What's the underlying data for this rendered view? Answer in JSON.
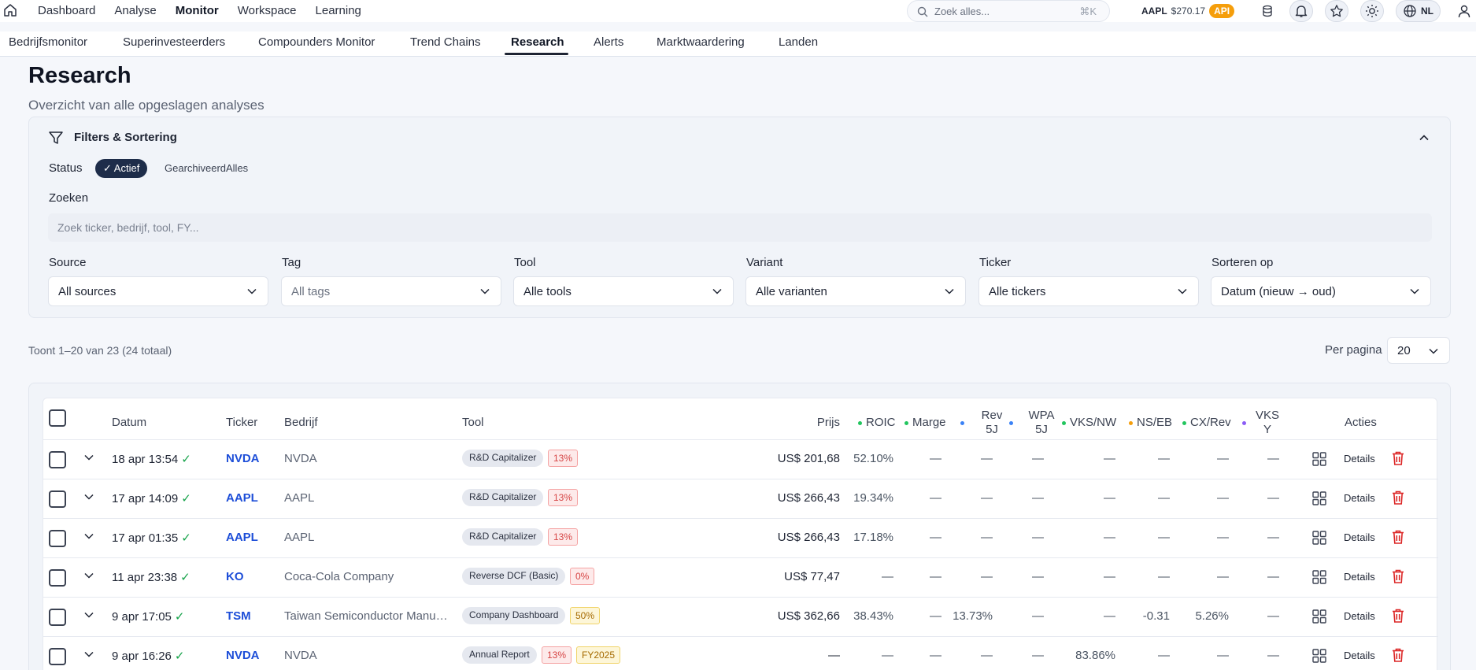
{
  "topnav": {
    "items": [
      "Dashboard",
      "Analyse",
      "Monitor",
      "Workspace",
      "Learning"
    ],
    "active": "Monitor",
    "search_placeholder": "Zoek alles...",
    "search_shortcut": "⌘K",
    "ticker_symbol": "AAPL",
    "ticker_price": "$270.17",
    "api_badge": "API",
    "language": "NL"
  },
  "subnav": {
    "items": [
      "Bedrijfsmonitor",
      "Superinvesteerders",
      "Compounders Monitor",
      "Trend Chains",
      "Research",
      "Alerts",
      "Marktwaardering",
      "Landen"
    ],
    "active": "Research"
  },
  "page": {
    "title": "Research",
    "subtitle": "Overzicht van alle opgeslagen analyses"
  },
  "filters": {
    "title": "Filters & Sortering",
    "status_label": "Status",
    "status_options": [
      "✓ Actief",
      "Gearchiveerd",
      "Alles"
    ],
    "search_label": "Zoeken",
    "search_placeholder": "Zoek ticker, bedrijf, tool, FY...",
    "selects": [
      {
        "label": "Source",
        "value": "All sources"
      },
      {
        "label": "Tag",
        "value": "All tags"
      },
      {
        "label": "Tool",
        "value": "Alle tools"
      },
      {
        "label": "Variant",
        "value": "Alle varianten"
      },
      {
        "label": "Ticker",
        "value": "Alle tickers"
      },
      {
        "label": "Sorteren op",
        "value": "Datum (nieuw → oud)"
      }
    ]
  },
  "results": {
    "count_text": "Toont 1–20 van 23 (24 totaal)",
    "per_page_label": "Per pagina",
    "per_page_value": "20"
  },
  "table": {
    "headers": {
      "datum": "Datum",
      "ticker": "Ticker",
      "bedrijf": "Bedrijf",
      "tool": "Tool",
      "prijs": "Prijs",
      "roic": "ROIC",
      "marge": "Marge",
      "rev1": "Rev",
      "rev2": "5J",
      "wpa1": "WPA",
      "wpa2": "5J",
      "vks_nw": "VKS/NW",
      "ns_eb": "NS/EB",
      "cx_rev": "CX/Rev",
      "vks1": "VKS",
      "vks2": "Y",
      "acties": "Acties"
    },
    "header_dot_colors": {
      "roic": "#22c55e",
      "marge": "#22c55e",
      "rev": "#3b82f6",
      "wpa": "#3b82f6",
      "vks_nw": "#22c55e",
      "ns_eb": "#f59e0b",
      "cx_rev": "#22c55e",
      "vks_y": "#8b5cf6"
    },
    "details_label": "Details",
    "rows": [
      {
        "date": "18 apr 13:54",
        "check": "✓",
        "ticker": "NVDA",
        "company": "NVDA",
        "tool": "R&D Capitalizer",
        "badge": "13%",
        "badge2": "",
        "price": "US$ 201,68",
        "roic": "52.10%",
        "marge": "—",
        "rev": "—",
        "wpa": "—",
        "vks_nw": "—",
        "ns_eb": "—",
        "cx_rev": "—",
        "vks_y": "—"
      },
      {
        "date": "17 apr 14:09",
        "check": "✓",
        "ticker": "AAPL",
        "company": "AAPL",
        "tool": "R&D Capitalizer",
        "badge": "13%",
        "badge2": "",
        "price": "US$ 266,43",
        "roic": "19.34%",
        "marge": "—",
        "rev": "—",
        "wpa": "—",
        "vks_nw": "—",
        "ns_eb": "—",
        "cx_rev": "—",
        "vks_y": "—"
      },
      {
        "date": "17 apr 01:35",
        "check": "✓",
        "ticker": "AAPL",
        "company": "AAPL",
        "tool": "R&D Capitalizer",
        "badge": "13%",
        "badge2": "",
        "price": "US$ 266,43",
        "roic": "17.18%",
        "marge": "—",
        "rev": "—",
        "wpa": "—",
        "vks_nw": "—",
        "ns_eb": "—",
        "cx_rev": "—",
        "vks_y": "—"
      },
      {
        "date": "11 apr 23:38",
        "check": "✓",
        "ticker": "KO",
        "company": "Coca-Cola Company",
        "tool": "Reverse DCF (Basic)",
        "badge": "0%",
        "badge2": "",
        "price": "US$ 77,47",
        "roic": "—",
        "marge": "—",
        "rev": "—",
        "wpa": "—",
        "vks_nw": "—",
        "ns_eb": "—",
        "cx_rev": "—",
        "vks_y": "—"
      },
      {
        "date": "9 apr 17:05",
        "check": "✓",
        "ticker": "TSM",
        "company": "Taiwan Semiconductor Manufa...",
        "tool": "Company Dashboard",
        "badge": "50%",
        "badge2": "",
        "price": "US$ 362,66",
        "roic": "38.43%",
        "marge": "—",
        "rev": "13.73%",
        "wpa": "—",
        "vks_nw": "—",
        "ns_eb": "-0.31",
        "cx_rev": "5.26%",
        "vks_y": "—"
      },
      {
        "date": "9 apr 16:26",
        "check": "✓",
        "ticker": "NVDA",
        "company": "NVDA",
        "tool": "Annual Report",
        "badge": "13%",
        "badge2": "FY2025",
        "price": "—",
        "roic": "—",
        "marge": "—",
        "rev": "—",
        "wpa": "—",
        "vks_nw": "83.86%",
        "ns_eb": "—",
        "cx_rev": "—",
        "vks_y": "—"
      }
    ]
  },
  "colors": {
    "accent": "#1e2d4a",
    "ticker_link": "#1d4ed8",
    "api": "#f59e0b",
    "delete": "#dc2626",
    "check": "#16a34a"
  }
}
